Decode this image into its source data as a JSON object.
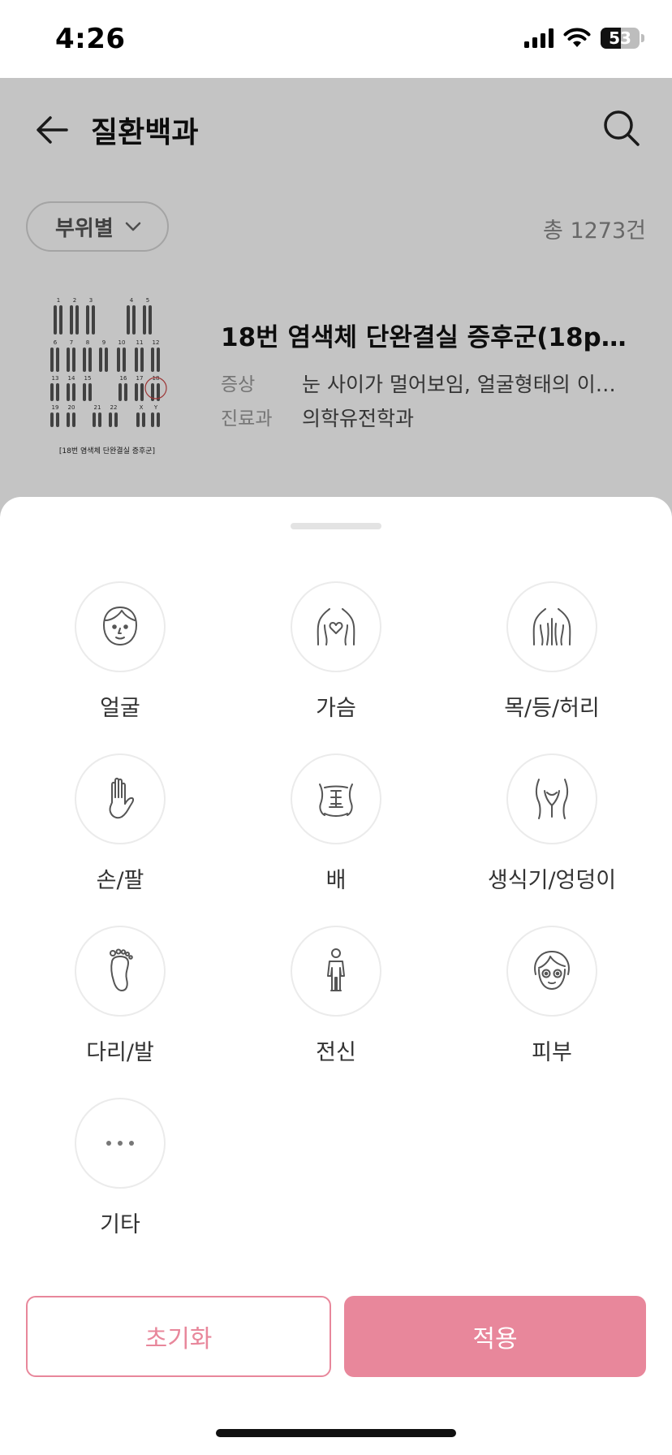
{
  "status_bar": {
    "time": "4:26",
    "battery": "53",
    "battery_level": 0.53
  },
  "header": {
    "title": "질환백과",
    "back_icon": "arrow-left-icon",
    "search_icon": "search-icon"
  },
  "filter": {
    "label": "부위별",
    "count_text": "총 1273건"
  },
  "results": [
    {
      "title": "18번 염색체 단완결실 증후군(18p…",
      "symptom_label": "증상",
      "symptom_value": "눈 사이가 멀어보임, 얼굴형태의 이…",
      "dept_label": "진료과",
      "dept_value": "의학유전학과",
      "thumb_caption": "[18번 염색체 단완결실 증후군]",
      "thumb_numbers": [
        "1",
        "2",
        "3",
        "4",
        "5",
        "6",
        "7",
        "8",
        "9",
        "10",
        "11",
        "12",
        "13",
        "14",
        "15",
        "16",
        "17",
        "18",
        "19",
        "20",
        "21",
        "22",
        "X",
        "Y"
      ]
    }
  ],
  "sheet": {
    "categories": [
      {
        "label": "얼굴",
        "icon": "face-icon"
      },
      {
        "label": "가슴",
        "icon": "chest-icon"
      },
      {
        "label": "목/등/허리",
        "icon": "back-icon"
      },
      {
        "label": "손/팔",
        "icon": "hand-icon"
      },
      {
        "label": "배",
        "icon": "belly-icon"
      },
      {
        "label": "생식기/엉덩이",
        "icon": "pelvis-icon"
      },
      {
        "label": "다리/발",
        "icon": "foot-icon"
      },
      {
        "label": "전신",
        "icon": "whole-body-icon"
      },
      {
        "label": "피부",
        "icon": "skin-icon"
      },
      {
        "label": "기타",
        "icon": "more-icon"
      }
    ],
    "reset_label": "초기화",
    "apply_label": "적용"
  },
  "colors": {
    "accent": "#E8879B",
    "dim_overlay": "rgba(0,0,0,0.23)"
  }
}
